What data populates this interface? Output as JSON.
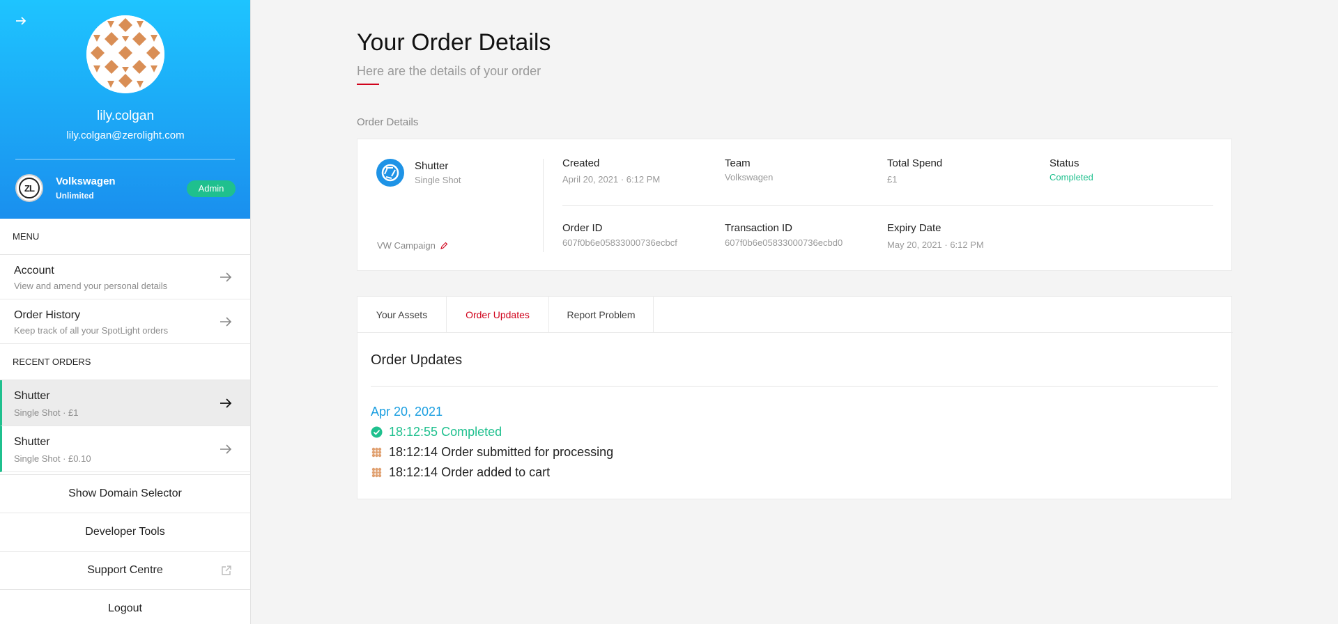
{
  "profile": {
    "username": "lily.colgan",
    "email": "lily.colgan@zerolight.com",
    "org_logo_text": "ZL",
    "org_name": "Volkswagen",
    "org_plan": "Unlimited",
    "role_badge": "Admin"
  },
  "sidebar": {
    "menu_heading": "MENU",
    "menu_items": [
      {
        "title": "Account",
        "subtitle": "View and amend your personal details"
      },
      {
        "title": "Order History",
        "subtitle": "Keep track of all your SpotLight orders"
      }
    ],
    "recent_heading": "RECENT ORDERS",
    "recent_orders": [
      {
        "title": "Shutter",
        "subtitle": "Single Shot · £1"
      },
      {
        "title": "Shutter",
        "subtitle": "Single Shot · £0.10"
      }
    ],
    "footer": {
      "domain_selector": "Show Domain Selector",
      "developer_tools": "Developer Tools",
      "support_centre": "Support Centre",
      "logout": "Logout"
    }
  },
  "header": {
    "title": "Your Order Details",
    "subtitle": "Here are the details of your order"
  },
  "order_details": {
    "section_label": "Order Details",
    "service_name": "Shutter",
    "service_type": "Single Shot",
    "campaign": "VW Campaign",
    "created_label": "Created",
    "created_value": "April 20, 2021 · 6:12 PM",
    "team_label": "Team",
    "team_value": "Volkswagen",
    "spend_label": "Total Spend",
    "spend_value": "£1",
    "status_label": "Status",
    "status_value": "Completed",
    "order_id_label": "Order ID",
    "order_id_value": "607f0b6e05833000736ecbcf",
    "transaction_id_label": "Transaction ID",
    "transaction_id_value": "607f0b6e05833000736ecbd0",
    "expiry_label": "Expiry Date",
    "expiry_value": "May 20, 2021 · 6:12 PM"
  },
  "tabs": [
    "Your Assets",
    "Order Updates",
    "Report Problem"
  ],
  "active_tab": "Order Updates",
  "updates": {
    "title": "Order Updates",
    "date": "Apr 20, 2021",
    "entries": [
      {
        "text": "18:12:55 Completed",
        "status": "completed"
      },
      {
        "text": "18:12:14 Order submitted for processing",
        "status": "info"
      },
      {
        "text": "18:12:14 Order added to cart",
        "status": "info"
      }
    ]
  },
  "colors": {
    "brand_gradient_top": "#1ec4ff",
    "brand_gradient_bottom": "#1a8fee",
    "accent_red": "#d0021b",
    "success_green": "#1fc08e",
    "link_blue": "#1a9ee0"
  }
}
